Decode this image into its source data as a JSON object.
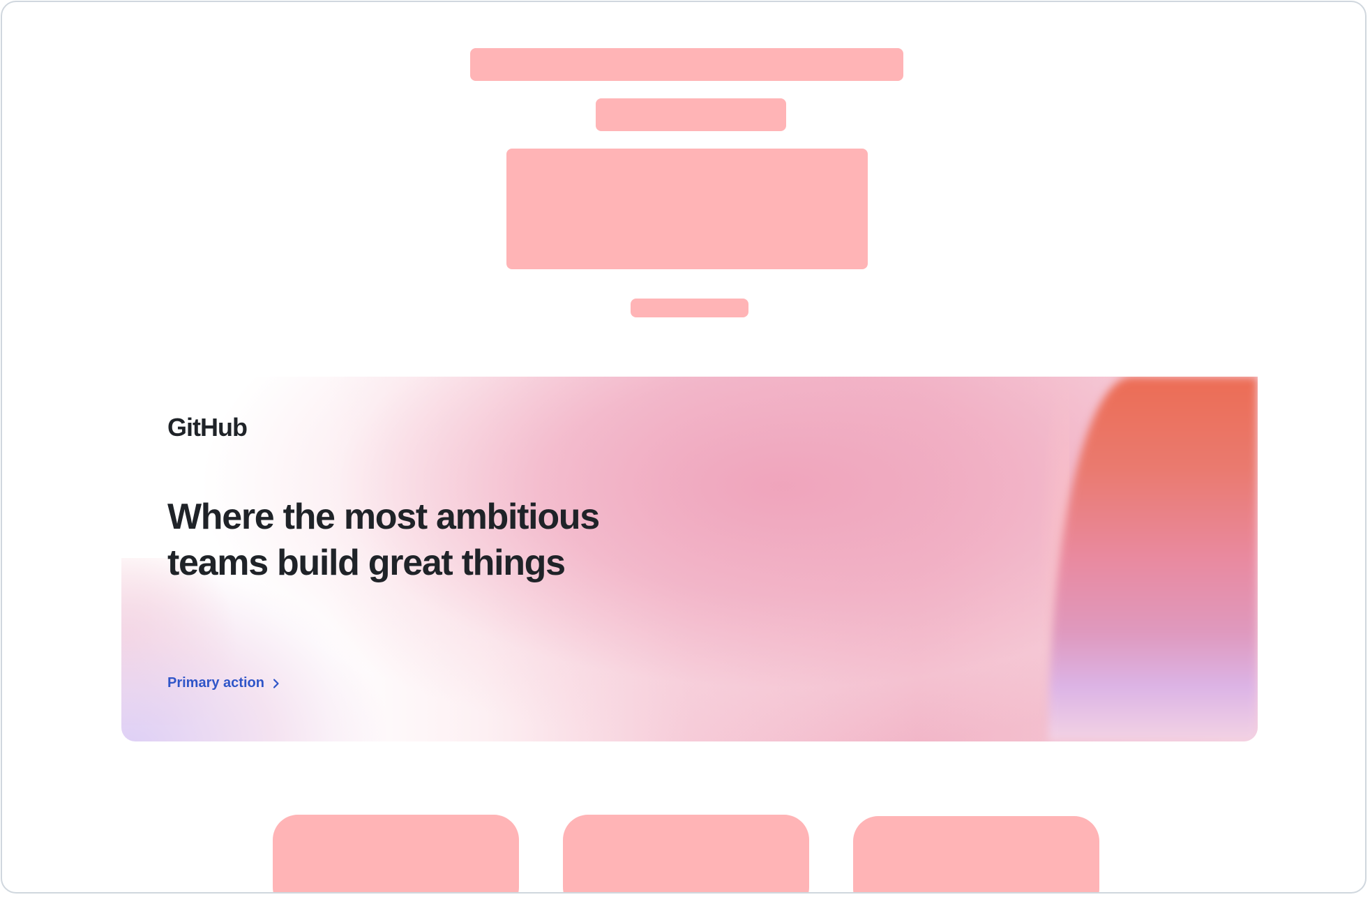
{
  "banner": {
    "logo_text": "GitHub",
    "headline": "Where the most ambitious teams build great things",
    "cta_label": "Primary action",
    "cta_icon": "chevron-right-icon"
  },
  "placeholders": {
    "color": "#ffb4b6"
  },
  "colors": {
    "cta": "#2f55c8",
    "text": "#1f2328",
    "frame_border": "#d0d7de"
  }
}
